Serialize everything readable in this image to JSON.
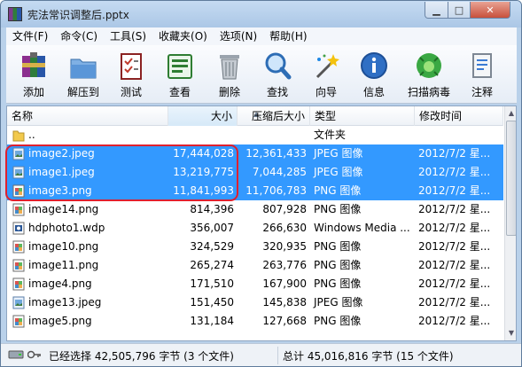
{
  "window": {
    "title": "宪法常识调整后.pptx"
  },
  "menu": [
    "文件(F)",
    "命令(C)",
    "工具(S)",
    "收藏夹(O)",
    "选项(N)",
    "帮助(H)"
  ],
  "toolbar": [
    {
      "label": "添加",
      "icon": "add-archive-icon"
    },
    {
      "label": "解压到",
      "icon": "extract-to-icon"
    },
    {
      "label": "测试",
      "icon": "test-icon"
    },
    {
      "label": "查看",
      "icon": "view-icon"
    },
    {
      "label": "删除",
      "icon": "delete-icon"
    },
    {
      "label": "查找",
      "icon": "find-icon"
    },
    {
      "label": "向导",
      "icon": "wizard-icon"
    },
    {
      "label": "信息",
      "icon": "info-icon"
    },
    {
      "label": "扫描病毒",
      "icon": "virus-scan-icon"
    },
    {
      "label": "注释",
      "icon": "comment-icon"
    }
  ],
  "columns": {
    "name": "名称",
    "size": "大小",
    "packed": "压缩后大小",
    "type": "类型",
    "modified": "修改时间"
  },
  "files": [
    {
      "name": "..",
      "size": "",
      "packed": "",
      "type": "文件夹",
      "modified": "",
      "icon": "folder-icon",
      "selected": false
    },
    {
      "name": "image2.jpeg",
      "size": "17,444,028",
      "packed": "12,361,433",
      "type": "JPEG 图像",
      "modified": "2012/7/2 星...",
      "icon": "jpeg-file-icon",
      "selected": true
    },
    {
      "name": "image1.jpeg",
      "size": "13,219,775",
      "packed": "7,044,285",
      "type": "JPEG 图像",
      "modified": "2012/7/2 星...",
      "icon": "jpeg-file-icon",
      "selected": true
    },
    {
      "name": "image3.png",
      "size": "11,841,993",
      "packed": "11,706,783",
      "type": "PNG 图像",
      "modified": "2012/7/2 星...",
      "icon": "png-file-icon",
      "selected": true
    },
    {
      "name": "image14.png",
      "size": "814,396",
      "packed": "807,928",
      "type": "PNG 图像",
      "modified": "2012/7/2 星...",
      "icon": "png-file-icon",
      "selected": false
    },
    {
      "name": "hdphoto1.wdp",
      "size": "356,007",
      "packed": "266,630",
      "type": "Windows Media ...",
      "modified": "2012/7/2 星...",
      "icon": "wdp-file-icon",
      "selected": false
    },
    {
      "name": "image10.png",
      "size": "324,529",
      "packed": "320,935",
      "type": "PNG 图像",
      "modified": "2012/7/2 星...",
      "icon": "png-file-icon",
      "selected": false
    },
    {
      "name": "image11.png",
      "size": "265,274",
      "packed": "263,776",
      "type": "PNG 图像",
      "modified": "2012/7/2 星...",
      "icon": "png-file-icon",
      "selected": false
    },
    {
      "name": "image4.png",
      "size": "171,510",
      "packed": "167,900",
      "type": "PNG 图像",
      "modified": "2012/7/2 星...",
      "icon": "png-file-icon",
      "selected": false
    },
    {
      "name": "image13.jpeg",
      "size": "151,450",
      "packed": "145,838",
      "type": "JPEG 图像",
      "modified": "2012/7/2 星...",
      "icon": "jpeg-file-icon",
      "selected": false
    },
    {
      "name": "image5.png",
      "size": "131,184",
      "packed": "127,668",
      "type": "PNG 图像",
      "modified": "2012/7/2 星...",
      "icon": "png-file-icon",
      "selected": false
    }
  ],
  "status": {
    "left": "已经选择 42,505,796 字节 (3 个文件)",
    "right": "总计 45,016,816 字节 (15 个文件)"
  }
}
